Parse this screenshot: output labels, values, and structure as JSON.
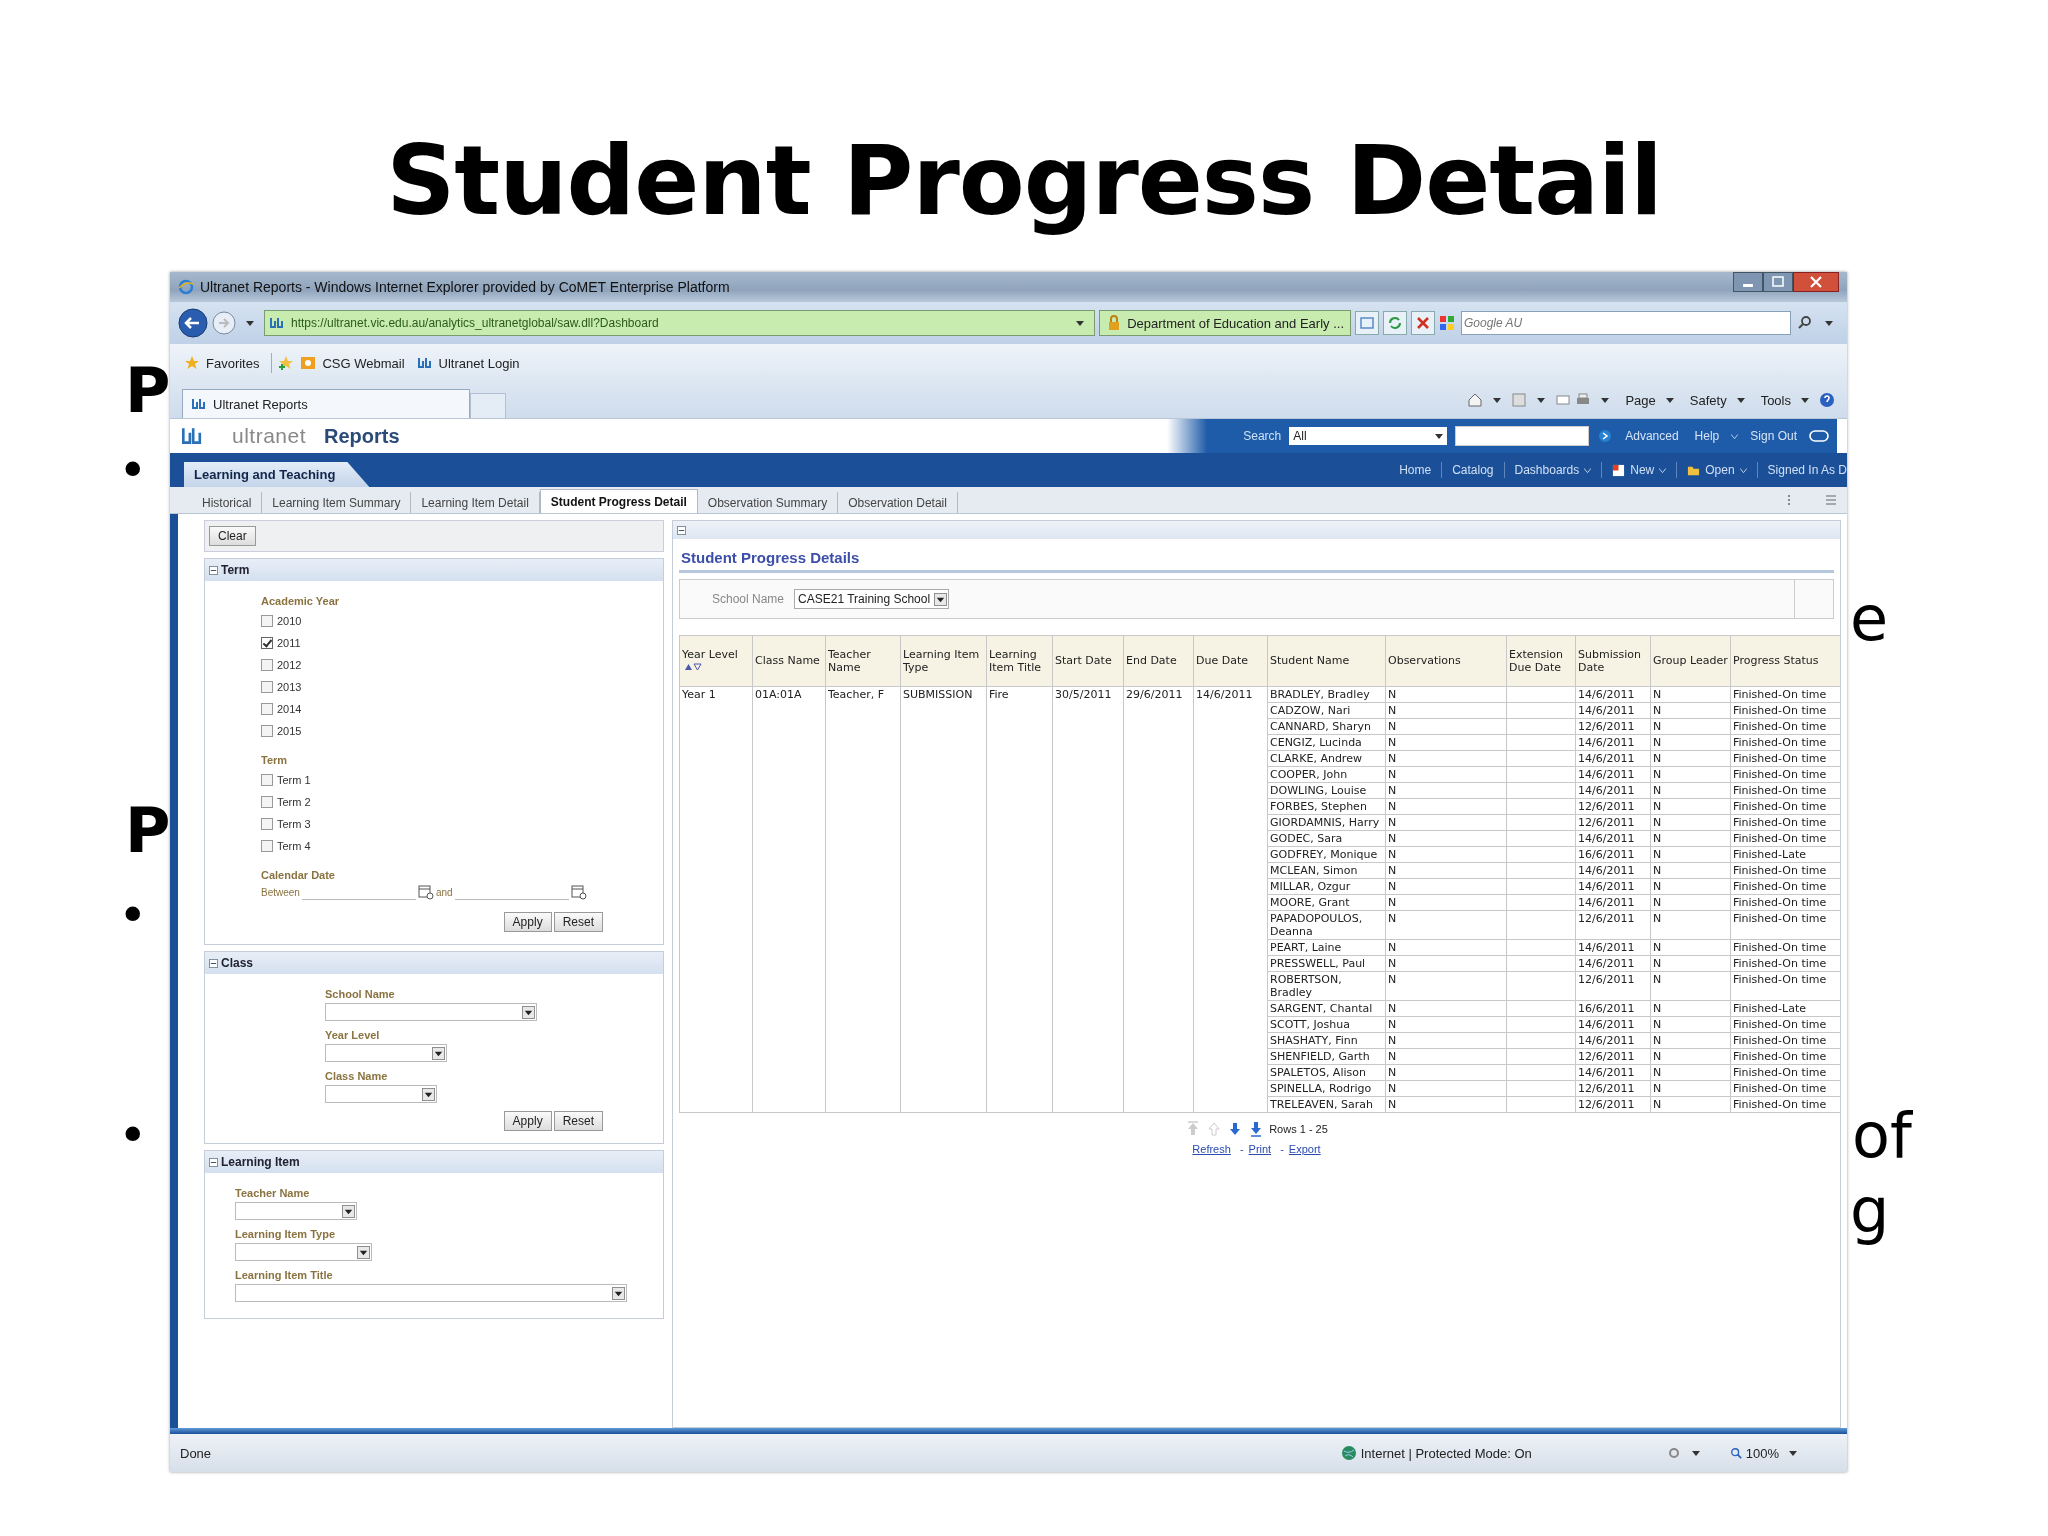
{
  "slide": {
    "title": "Student Progress Detail",
    "fragments": [
      {
        "text": "P",
        "kind": "heading"
      },
      {
        "text": "•",
        "kind": "bullet"
      },
      {
        "text": "P",
        "kind": "heading"
      },
      {
        "text": "•",
        "kind": "bullet"
      },
      {
        "text": "•",
        "kind": "bullet"
      },
      {
        "text": "e",
        "kind": "body"
      },
      {
        "text": "of",
        "kind": "body"
      },
      {
        "text": "g",
        "kind": "body"
      }
    ]
  },
  "browser": {
    "title": "Ultranet Reports - Windows Internet Explorer provided by CoMET Enterprise Platform",
    "url": "https://ultranet.vic.edu.au/analytics_ultranetglobal/saw.dll?Dashboard",
    "security": "Department of Education and Early ...",
    "search_placeholder": "Google AU",
    "favorites_button": "Favorites",
    "favorites": [
      "CSG Webmail",
      "Ultranet Login"
    ],
    "tab": "Ultranet Reports",
    "commands": [
      "Page",
      "Safety",
      "Tools"
    ]
  },
  "app": {
    "brand": "ultranet",
    "product": "Reports",
    "search_label": "Search",
    "search_scope": "All",
    "header_links": [
      "Advanced",
      "Help",
      "Sign Out"
    ],
    "section_tab": "Learning and Teaching",
    "nav_links": [
      "Home",
      "Catalog",
      "Dashboards",
      "New",
      "Open",
      "Signed In As D"
    ]
  },
  "dashboard_tabs": [
    {
      "label": "Historical",
      "selected": false
    },
    {
      "label": "Learning Item Summary",
      "selected": false
    },
    {
      "label": "Learning Item Detail",
      "selected": false
    },
    {
      "label": "Student Progress Detail",
      "selected": true
    },
    {
      "label": "Observation Summary",
      "selected": false
    },
    {
      "label": "Observation Detail",
      "selected": false
    }
  ],
  "filters": {
    "clear_button": "Clear",
    "sections": [
      {
        "title": "Term",
        "groups": [
          {
            "kind": "checkboxes",
            "label": "Academic Year",
            "options": [
              {
                "label": "2010",
                "checked": false
              },
              {
                "label": "2011",
                "checked": true
              },
              {
                "label": "2012",
                "checked": false
              },
              {
                "label": "2013",
                "checked": false
              },
              {
                "label": "2014",
                "checked": false
              },
              {
                "label": "2015",
                "checked": false
              }
            ]
          },
          {
            "kind": "checkboxes",
            "label": "Term",
            "options": [
              {
                "label": "Term 1",
                "checked": false
              },
              {
                "label": "Term 2",
                "checked": false
              },
              {
                "label": "Term 3",
                "checked": false
              },
              {
                "label": "Term 4",
                "checked": false
              }
            ]
          },
          {
            "kind": "date_range",
            "label": "Calendar Date",
            "between": "Between",
            "and": "and"
          }
        ],
        "actions": [
          "Apply",
          "Reset"
        ]
      },
      {
        "title": "Class",
        "groups": [
          {
            "kind": "select",
            "label": "School Name"
          },
          {
            "kind": "select",
            "label": "Year Level"
          },
          {
            "kind": "select",
            "label": "Class Name"
          }
        ],
        "actions": [
          "Apply",
          "Reset"
        ]
      },
      {
        "title": "Learning Item",
        "groups": [
          {
            "kind": "select",
            "label": "Teacher Name"
          },
          {
            "kind": "select",
            "label": "Learning Item Type"
          },
          {
            "kind": "select",
            "label": "Learning Item Title"
          }
        ]
      }
    ]
  },
  "report": {
    "title": "Student Progress Details",
    "school_label": "School Name",
    "school_value": "CASE21 Training School",
    "table": {
      "columns": [
        "Year Level",
        "Class Name",
        "Teacher Name",
        "Learning Item Type",
        "Learning Item Title",
        "Start Date",
        "End Date",
        "Due Date",
        "Student Name",
        "Observations",
        "Extension Due Date",
        "Submission Date",
        "Group Leader",
        "Progress Status"
      ],
      "group": [
        "Year 1",
        "01A:01A",
        "Teacher, F",
        "SUBMISSION",
        "Fire",
        "30/5/2011",
        "29/6/2011",
        "14/6/2011"
      ],
      "students": [
        {
          "name": "BRADLEY, Bradley",
          "observations": "N",
          "submission_date": "14/6/2011",
          "group_leader": "N",
          "progress_status": "Finished-On time"
        },
        {
          "name": "CADZOW, Nari",
          "observations": "N",
          "submission_date": "14/6/2011",
          "group_leader": "N",
          "progress_status": "Finished-On time"
        },
        {
          "name": "CANNARD, Sharyn",
          "observations": "N",
          "submission_date": "12/6/2011",
          "group_leader": "N",
          "progress_status": "Finished-On time"
        },
        {
          "name": "CENGIZ, Lucinda",
          "observations": "N",
          "submission_date": "14/6/2011",
          "group_leader": "N",
          "progress_status": "Finished-On time"
        },
        {
          "name": "CLARKE, Andrew",
          "observations": "N",
          "submission_date": "14/6/2011",
          "group_leader": "N",
          "progress_status": "Finished-On time"
        },
        {
          "name": "COOPER, John",
          "observations": "N",
          "submission_date": "14/6/2011",
          "group_leader": "N",
          "progress_status": "Finished-On time"
        },
        {
          "name": "DOWLING, Louise",
          "observations": "N",
          "submission_date": "14/6/2011",
          "group_leader": "N",
          "progress_status": "Finished-On time"
        },
        {
          "name": "FORBES, Stephen",
          "observations": "N",
          "submission_date": "12/6/2011",
          "group_leader": "N",
          "progress_status": "Finished-On time"
        },
        {
          "name": "GIORDAMNIS, Harry",
          "observations": "N",
          "submission_date": "12/6/2011",
          "group_leader": "N",
          "progress_status": "Finished-On time"
        },
        {
          "name": "GODEC, Sara",
          "observations": "N",
          "submission_date": "14/6/2011",
          "group_leader": "N",
          "progress_status": "Finished-On time"
        },
        {
          "name": "GODFREY, Monique",
          "observations": "N",
          "submission_date": "16/6/2011",
          "group_leader": "N",
          "progress_status": "Finished-Late"
        },
        {
          "name": "MCLEAN, Simon",
          "observations": "N",
          "submission_date": "14/6/2011",
          "group_leader": "N",
          "progress_status": "Finished-On time"
        },
        {
          "name": "MILLAR, Ozgur",
          "observations": "N",
          "submission_date": "14/6/2011",
          "group_leader": "N",
          "progress_status": "Finished-On time"
        },
        {
          "name": "MOORE, Grant",
          "observations": "N",
          "submission_date": "14/6/2011",
          "group_leader": "N",
          "progress_status": "Finished-On time"
        },
        {
          "name": "PAPADOPOULOS, Deanna",
          "observations": "N",
          "submission_date": "12/6/2011",
          "group_leader": "N",
          "progress_status": "Finished-On time"
        },
        {
          "name": "PEART, Laine",
          "observations": "N",
          "submission_date": "14/6/2011",
          "group_leader": "N",
          "progress_status": "Finished-On time"
        },
        {
          "name": "PRESSWELL, Paul",
          "observations": "N",
          "submission_date": "14/6/2011",
          "group_leader": "N",
          "progress_status": "Finished-On time"
        },
        {
          "name": "ROBERTSON, Bradley",
          "observations": "N",
          "submission_date": "12/6/2011",
          "group_leader": "N",
          "progress_status": "Finished-On time"
        },
        {
          "name": "SARGENT, Chantal",
          "observations": "N",
          "submission_date": "16/6/2011",
          "group_leader": "N",
          "progress_status": "Finished-Late"
        },
        {
          "name": "SCOTT, Joshua",
          "observations": "N",
          "submission_date": "14/6/2011",
          "group_leader": "N",
          "progress_status": "Finished-On time"
        },
        {
          "name": "SHASHATY, Finn",
          "observations": "N",
          "submission_date": "14/6/2011",
          "group_leader": "N",
          "progress_status": "Finished-On time"
        },
        {
          "name": "SHENFIELD, Garth",
          "observations": "N",
          "submission_date": "12/6/2011",
          "group_leader": "N",
          "progress_status": "Finished-On time"
        },
        {
          "name": "SPALETOS, Alison",
          "observations": "N",
          "submission_date": "14/6/2011",
          "group_leader": "N",
          "progress_status": "Finished-On time"
        },
        {
          "name": "SPINELLA, Rodrigo",
          "observations": "N",
          "submission_date": "12/6/2011",
          "group_leader": "N",
          "progress_status": "Finished-On time"
        },
        {
          "name": "TRELEAVEN, Sarah",
          "observations": "N",
          "submission_date": "12/6/2011",
          "group_leader": "N",
          "progress_status": "Finished-On time"
        }
      ]
    },
    "pager": {
      "rows_text": "Rows 1 - 25",
      "links": [
        {
          "label": "Refresh"
        },
        {
          "prefix": "-",
          "label": "Print"
        },
        {
          "prefix": "-",
          "label": "Export"
        }
      ]
    }
  },
  "status_bar": {
    "left": "Done",
    "zone": "Internet | Protected Mode: On",
    "zoom": "100%"
  }
}
